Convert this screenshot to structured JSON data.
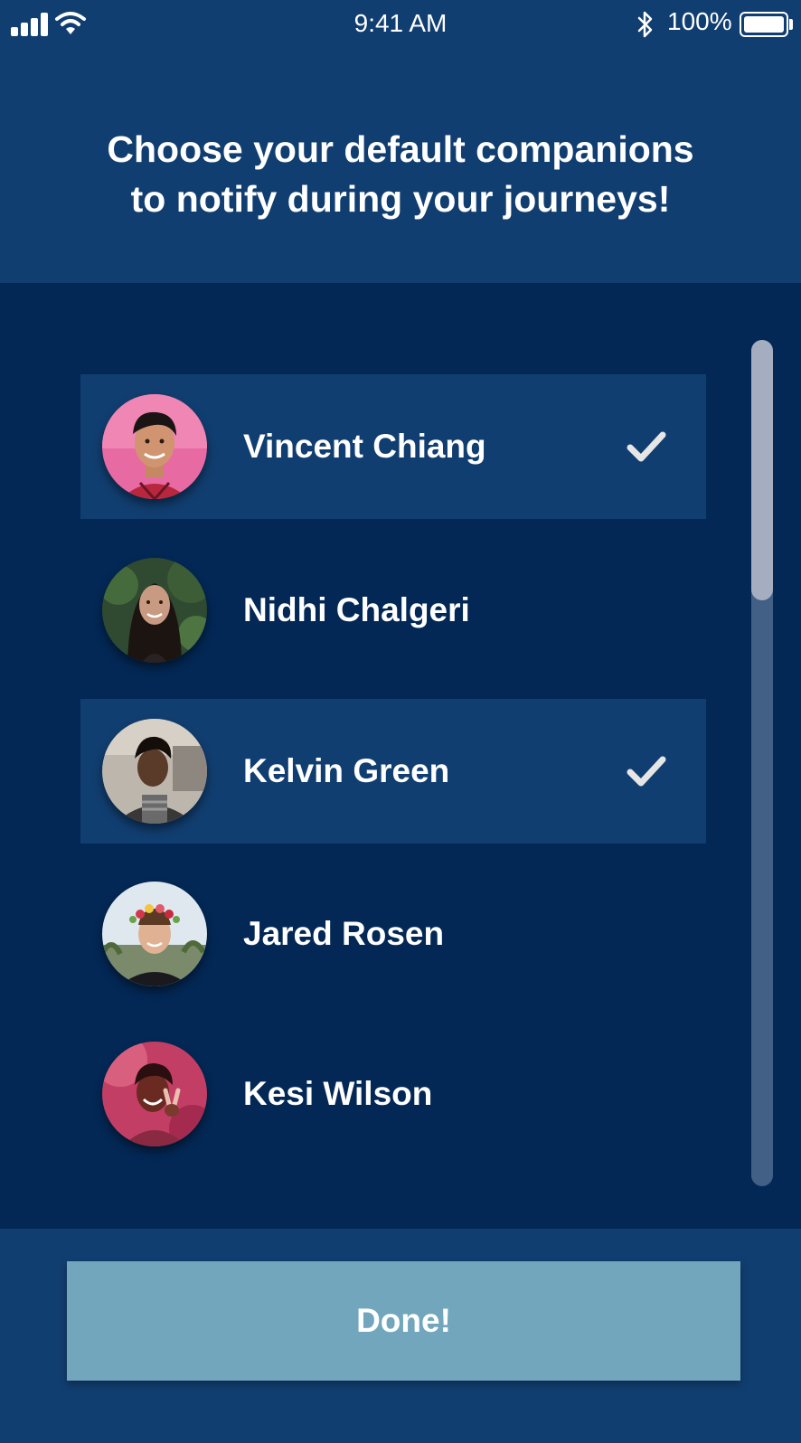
{
  "status_bar": {
    "time": "9:41 AM",
    "battery_percent": "100%",
    "signal_icon": "cellular-signal-icon",
    "wifi_icon": "wifi-icon",
    "bluetooth_icon": "bluetooth-icon",
    "battery_icon": "battery-icon",
    "battery_level": 1.0
  },
  "header": {
    "title": "Choose your default companions\nto notify during your journeys!"
  },
  "companions": [
    {
      "name": "Vincent Chiang",
      "selected": true
    },
    {
      "name": "Nidhi Chalgeri",
      "selected": false
    },
    {
      "name": "Kelvin Green",
      "selected": true
    },
    {
      "name": "Jared Rosen",
      "selected": false
    },
    {
      "name": "Kesi Wilson",
      "selected": false
    }
  ],
  "footer": {
    "done_label": "Done!"
  },
  "colors": {
    "header_bg": "#113e70",
    "list_bg": "#032855",
    "selected_row_bg": "#113e70",
    "button_bg": "#72a6bd",
    "check_color": "#e6e6e6",
    "scroll_thumb": "#a5aec0",
    "scroll_track": "#425f85"
  }
}
